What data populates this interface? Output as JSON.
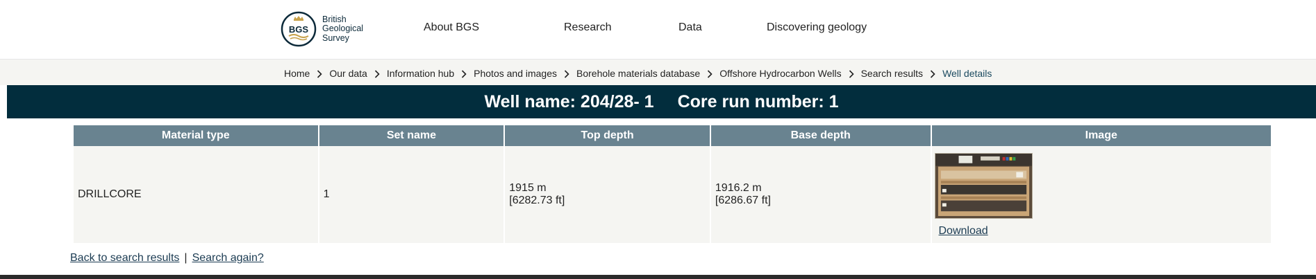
{
  "header": {
    "logo": {
      "mark_text": "BGS",
      "lines": [
        "British",
        "Geological",
        "Survey"
      ]
    },
    "nav": [
      {
        "label": "About BGS"
      },
      {
        "label": "Research"
      },
      {
        "label": "Data"
      },
      {
        "label": "Discovering geology"
      }
    ]
  },
  "breadcrumb": [
    {
      "label": "Home"
    },
    {
      "label": "Our data"
    },
    {
      "label": "Information hub"
    },
    {
      "label": "Photos and images"
    },
    {
      "label": "Borehole materials database"
    },
    {
      "label": "Offshore Hydrocarbon Wells"
    },
    {
      "label": "Search results"
    },
    {
      "label": "Well details"
    }
  ],
  "banner": {
    "well_name": "Well name: 204/28- 1",
    "core_run": "Core run number: 1"
  },
  "table": {
    "headers": [
      "Material type",
      "Set name",
      "Top depth",
      "Base depth",
      "Image"
    ],
    "rows": [
      {
        "material_type": "DRILLCORE",
        "set_name": "1",
        "top_depth_m": "1915  m",
        "top_depth_ft": "[6282.73 ft]",
        "base_depth_m": "1916.2  m",
        "base_depth_ft": "[6286.67 ft]",
        "image_link": "Download"
      }
    ]
  },
  "links": {
    "back": "Back to search results",
    "separator": "|",
    "again": "Search again?"
  },
  "colors": {
    "banner": "#022d3d",
    "table_header": "#698390",
    "cell_bg": "#f5f5f2",
    "link": "#1b3b52"
  }
}
